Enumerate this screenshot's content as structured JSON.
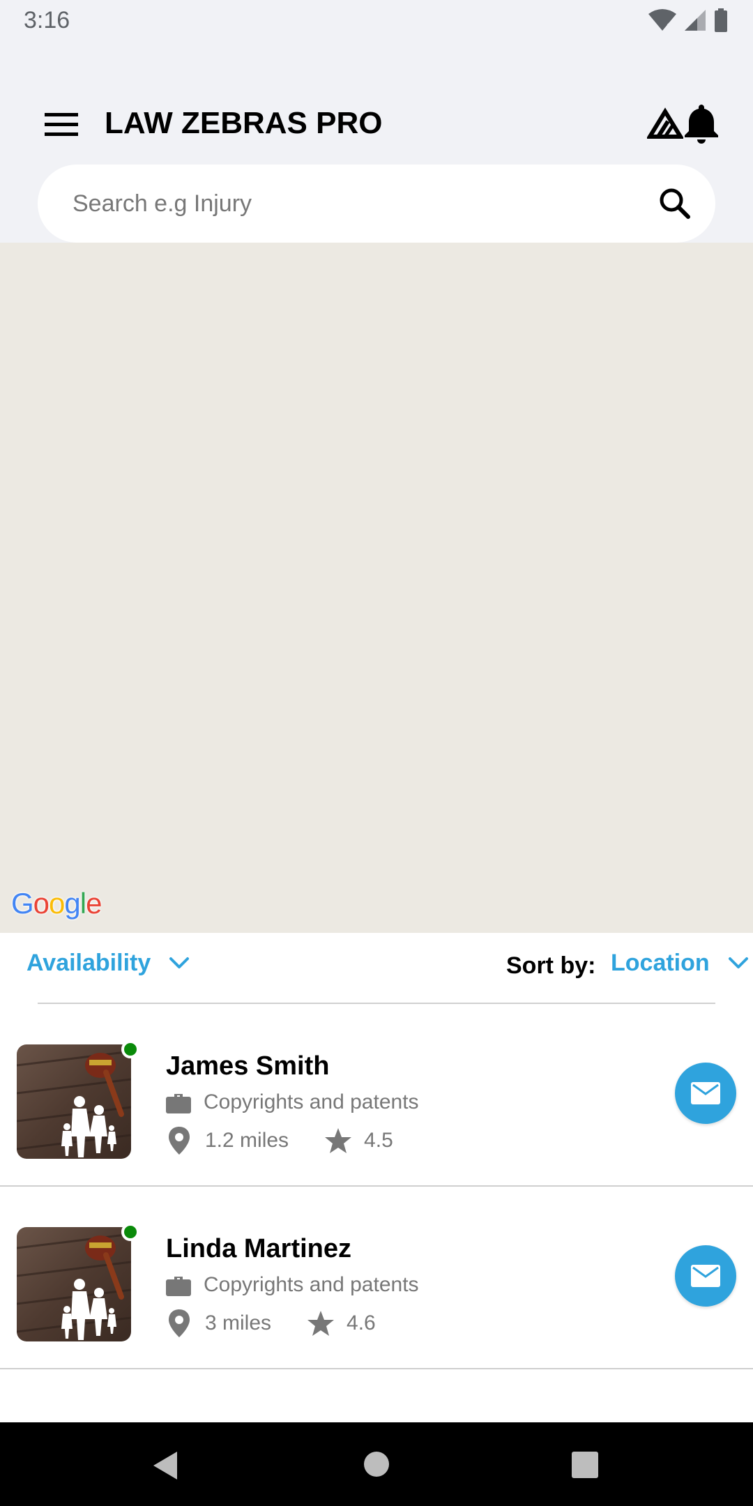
{
  "status_bar": {
    "time": "3:16",
    "icons": [
      "wifi-icon",
      "signal-icon",
      "battery-icon"
    ]
  },
  "app_bar": {
    "title": "LAW ZEBRAS PRO",
    "menu_icon": "hamburger-menu-icon",
    "brand_icon": "law-zebras-logo-icon",
    "notification_icon": "bell-icon"
  },
  "search": {
    "placeholder": "Search e.g Injury",
    "value": "",
    "icon": "search-icon"
  },
  "map": {
    "attribution": "Google"
  },
  "filters": {
    "availability_label": "Availability",
    "sort_label": "Sort by:",
    "sort_value": "Location",
    "accent_color": "#2fa3dd"
  },
  "lawyers": [
    {
      "name": "James Smith",
      "practice": "Copyrights and patents",
      "distance": "1.2 miles",
      "rating": "4.5",
      "online": true
    },
    {
      "name": "Linda Martinez",
      "practice": "Copyrights and patents",
      "distance": "3 miles",
      "rating": "4.6",
      "online": true
    }
  ],
  "nav_bar": {
    "buttons": [
      "back-icon",
      "home-icon",
      "recents-icon"
    ]
  }
}
